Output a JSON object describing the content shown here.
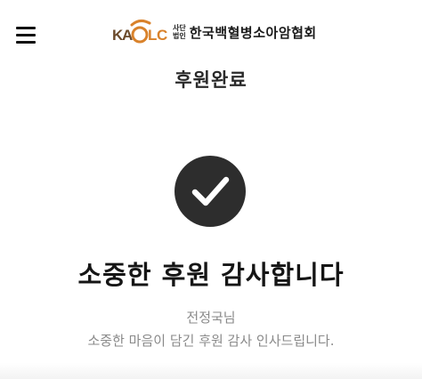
{
  "header": {
    "logo_text": "KAOLC",
    "logo_small_line1": "사단",
    "logo_small_line2": "법인",
    "org_name": "한국백혈병소아암협회",
    "menu_icon": "hamburger-menu-icon"
  },
  "page": {
    "title": "후원완료"
  },
  "main": {
    "status_icon": "checkmark-icon",
    "heading": "소중한 후원 감사합니다",
    "donor_name": "전정국님",
    "message": "소중한 마음이 담긴 후원 감사 인사드립니다."
  },
  "colors": {
    "check_circle": "#2d2d2d",
    "logo_orange": "#d9822b",
    "logo_brown": "#6b4a2b",
    "text_dark": "#151515",
    "text_muted": "#8a8a8a"
  }
}
